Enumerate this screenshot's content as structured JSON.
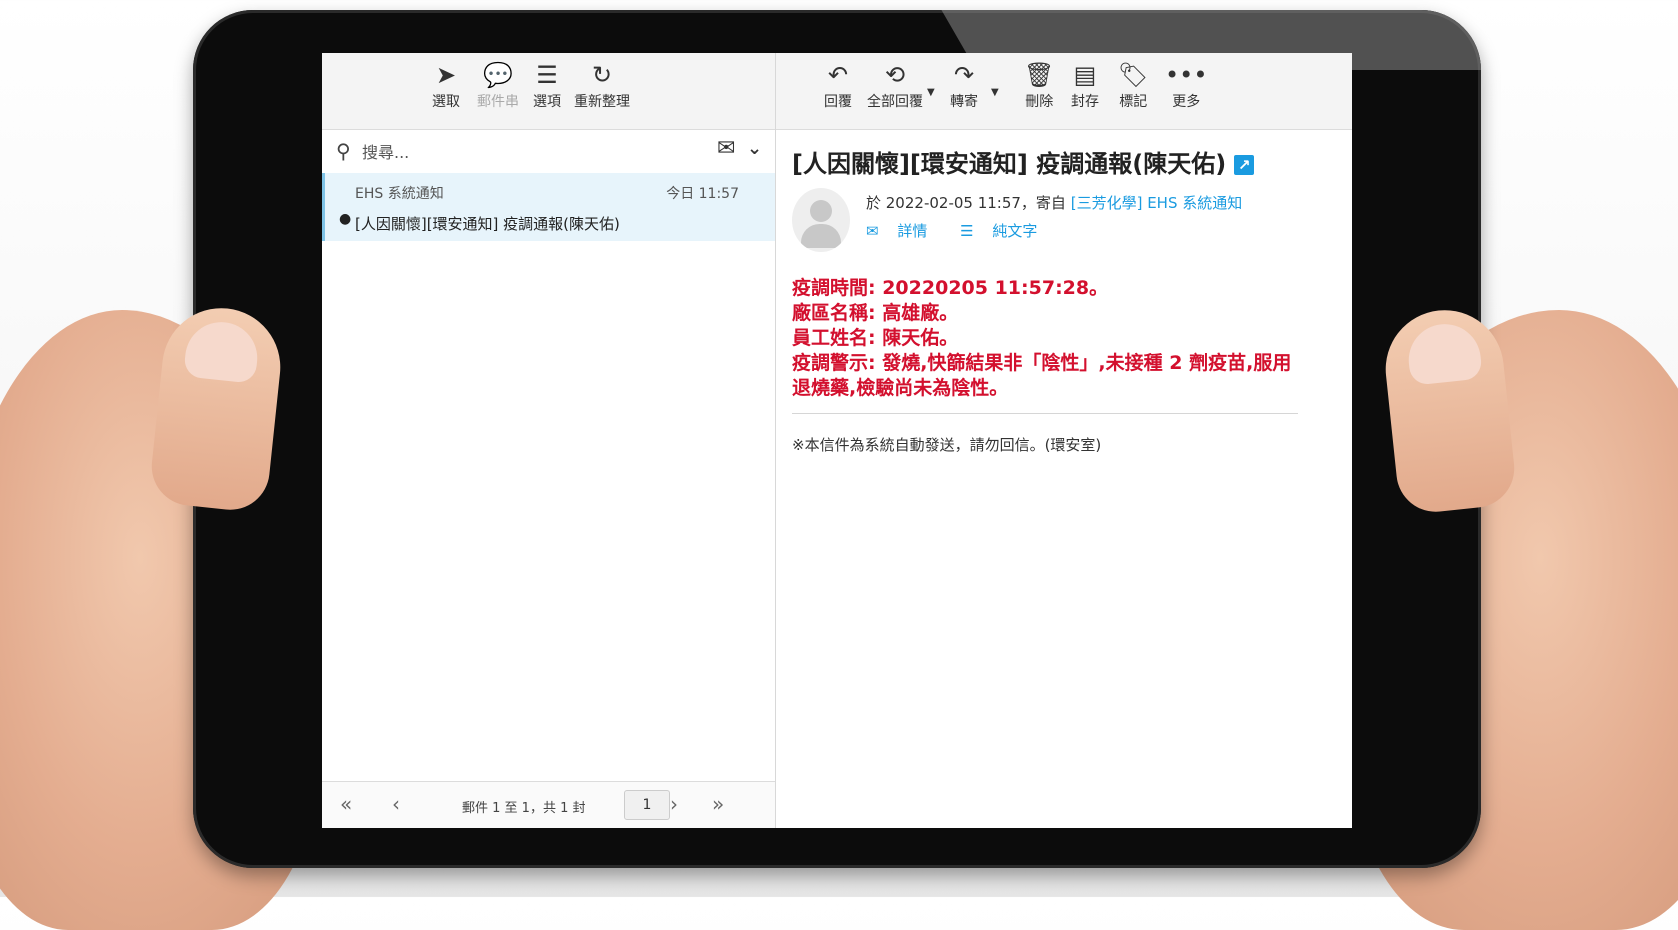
{
  "toolbar_left": {
    "select": "選取",
    "thread": "郵件串",
    "options": "選項",
    "refresh": "重新整理"
  },
  "toolbar_right": {
    "reply": "回覆",
    "reply_all": "全部回覆",
    "forward": "轉寄",
    "delete": "刪除",
    "archive": "封存",
    "mark": "標記",
    "more": "更多"
  },
  "search": {
    "placeholder": "搜尋..."
  },
  "message_list": [
    {
      "from": "EHS 系統通知",
      "date": "今日 11:57",
      "subject": "[人因關懷][環安通知] 疫調通報(陳天佑)"
    }
  ],
  "pager": {
    "info": "郵件 1 至 1，共 1 封",
    "page": "1"
  },
  "message": {
    "subject": "[人因關懷][環安通知] 疫調通報(陳天佑)",
    "meta_prefix": "於 2022-02-05 11:57，寄自 ",
    "sender": "[三芳化學] EHS 系統通知",
    "details_label": "詳情",
    "plaintext_label": "純文字",
    "body_lines": [
      "疫調時間: 20220205 11:57:28。",
      "廠區名稱: 高雄廠。",
      "員工姓名: 陳天佑。",
      "疫調警示: 發燒,快篩結果非「陰性」,未接種 2 劑疫苗,服用退燒藥,檢驗尚未為陰性。"
    ],
    "footer": "※本信件為系統自動發送，請勿回信。(環安室)"
  },
  "colors": {
    "accent": "#1a9be0",
    "alert": "#d3102e",
    "selected_row": "#e7f4fb"
  }
}
